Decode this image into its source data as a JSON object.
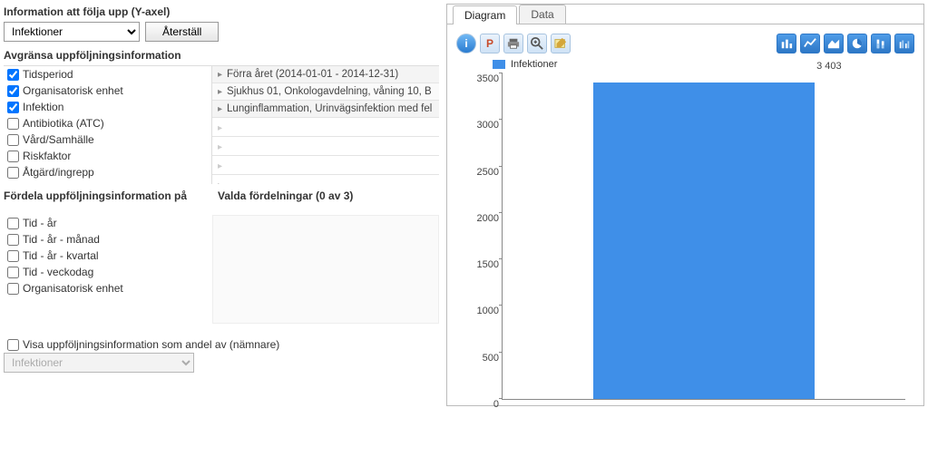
{
  "info_section": {
    "title": "Information att följa upp (Y-axel)",
    "select_value": "Infektioner",
    "reset_label": "Återställ"
  },
  "filter_section": {
    "title": "Avgränsa uppföljningsinformation",
    "left_items": [
      {
        "label": "Tidsperiod",
        "checked": true
      },
      {
        "label": "Organisatorisk enhet",
        "checked": true
      },
      {
        "label": "Infektion",
        "checked": true
      },
      {
        "label": "Antibiotika (ATC)",
        "checked": false
      },
      {
        "label": "Vård/Samhälle",
        "checked": false
      },
      {
        "label": "Riskfaktor",
        "checked": false
      },
      {
        "label": "Åtgärd/ingrepp",
        "checked": false
      }
    ],
    "right_rows": [
      "Förra året (2014-01-01 - 2014-12-31)",
      "Sjukhus 01, Onkologavdelning, våning 10, B",
      "Lunginflammation, Urinvägsinfektion med fel"
    ]
  },
  "dist_section": {
    "title": "Fördela uppföljningsinformation på",
    "valda_title": "Valda fördelningar (0 av 3)",
    "items": [
      {
        "label": "Tid - år",
        "checked": false
      },
      {
        "label": "Tid - år - månad",
        "checked": false
      },
      {
        "label": "Tid - år - kvartal",
        "checked": false
      },
      {
        "label": "Tid - veckodag",
        "checked": false
      },
      {
        "label": "Organisatorisk enhet",
        "checked": false
      }
    ]
  },
  "share_section": {
    "checkbox_label": "Visa uppföljningsinformation som andel av (nämnare)",
    "select_value": "Infektioner",
    "checked": false
  },
  "tabs": {
    "diagram": "Diagram",
    "data": "Data",
    "active": "diagram"
  },
  "toolbar_left": {
    "info_icon": "info-icon",
    "ppt_icon": "powerpoint-icon",
    "print_icon": "print-icon",
    "zoom_icon": "zoom-in-icon",
    "edit_icon": "edit-icon"
  },
  "toolbar_right": {
    "bar_icon": "bar-chart-icon",
    "line_icon": "line-chart-icon",
    "area_icon": "area-chart-icon",
    "pie_icon": "pie-chart-icon",
    "stacked_icon": "stacked-bar-icon",
    "grouped_icon": "grouped-bar-icon"
  },
  "chart_data": {
    "type": "bar",
    "categories": [
      ""
    ],
    "series": [
      {
        "name": "Infektioner",
        "values": [
          3403
        ],
        "label": "3 403",
        "color": "#3f8fe8"
      }
    ],
    "title": "",
    "xlabel": "",
    "ylabel": "",
    "ylim": [
      0,
      3500
    ],
    "yticks": [
      0,
      500,
      1000,
      1500,
      2000,
      2500,
      3000,
      3500
    ]
  }
}
